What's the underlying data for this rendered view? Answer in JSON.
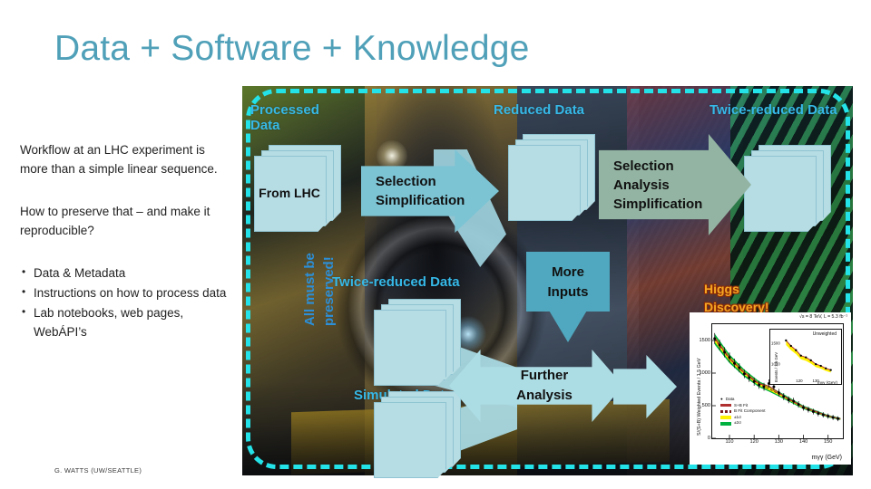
{
  "slide": {
    "title": "Data + Software + Knowledge",
    "title_color": "#4FA0B8",
    "footer_credit": "G. WATTS (UW/SEATTLE)"
  },
  "left_column": {
    "paragraph1": "Workflow at an LHC experiment is more than a simple linear sequence.",
    "paragraph2": "How to preserve that – and make it reproducible?",
    "bullets": [
      "Data & Metadata",
      "Instructions on how to process data",
      "Lab notebooks, web pages, WebÁPI’s"
    ]
  },
  "diagram": {
    "border_color": "#24E3E8",
    "label_color": "#36B9E8",
    "photo_labels": [
      "Processed Data",
      "Reduced Data",
      "Twice-reduced Data",
      "Twice-reduced Data",
      "Simulated Data"
    ],
    "processed_data_line1": "Processed",
    "processed_data_line2": "Data",
    "reduced_data": "Reduced Data",
    "twice_reduced_top": "Twice-reduced Data",
    "twice_reduced_mid": "Twice-reduced Data",
    "simulated_data": "Simulated Data",
    "preserved_line1": "All must be",
    "preserved_line2": "preserved!",
    "doc_from_lhc": "From LHC",
    "arrow_sel_simp_line1": "Selection",
    "arrow_sel_simp_line2": "Simplification",
    "arrow_sel_an_line1": "Selection",
    "arrow_sel_an_line2": "Analysis",
    "arrow_sel_an_line3": "Simplification",
    "more_inputs_line1": "More",
    "more_inputs_line2": "Inputs",
    "further_line1": "Further",
    "further_line2": "Analysis",
    "higgs_line1": "Higgs",
    "higgs_line2": "Discovery!",
    "higgs_color": "#F5A623"
  },
  "chart_data": {
    "type": "scatter",
    "title": "",
    "header_annotation": "√s = 8 TeV, L = 5.3 fb⁻¹",
    "xlabel": "mγγ (GeV)",
    "ylabel": "S/(S+B) Weighted Events / 1.5 GeV",
    "xlim": [
      103,
      156
    ],
    "ylim": [
      0,
      1750
    ],
    "xticks": [
      110,
      120,
      130,
      140,
      150
    ],
    "yticks": [
      0,
      500,
      1000,
      1500
    ],
    "grid": false,
    "legend_position": "lower-left",
    "legend": [
      "Data",
      "S+B Fit",
      "B Fit Component",
      "±1σ",
      "±2σ"
    ],
    "series": [
      {
        "name": "Data",
        "x": [
          104,
          106,
          108,
          110,
          112,
          114,
          116,
          118,
          120,
          122,
          124,
          126,
          128,
          130,
          132,
          134,
          136,
          138,
          140,
          142,
          144,
          146,
          148,
          150,
          152,
          154
        ],
        "values": [
          1530,
          1430,
          1320,
          1240,
          1150,
          1080,
          990,
          930,
          870,
          820,
          790,
          840,
          790,
          700,
          640,
          590,
          570,
          520,
          470,
          440,
          410,
          380,
          360,
          340,
          320,
          300
        ]
      },
      {
        "name": "S+B Fit",
        "x": [
          104,
          110,
          116,
          122,
          126,
          132,
          140,
          150,
          155
        ],
        "values": [
          1540,
          1230,
          1010,
          840,
          800,
          650,
          480,
          340,
          300
        ]
      },
      {
        "name": "B Fit Component",
        "x": [
          104,
          110,
          116,
          122,
          126,
          132,
          140,
          150,
          155
        ],
        "values": [
          1520,
          1220,
          1000,
          830,
          760,
          640,
          475,
          338,
          298
        ]
      }
    ],
    "inset": {
      "type": "scatter",
      "title": "Unweighted",
      "xlabel": "mγγ (GeV)",
      "ylabel": "Events / 1.5 GeV",
      "xticks": [
        120,
        130
      ],
      "yticks": [
        1000,
        1500
      ],
      "x": [
        112,
        115,
        118,
        121,
        124,
        127,
        130,
        133,
        136,
        139
      ],
      "values": [
        1560,
        1430,
        1330,
        1200,
        1160,
        1090,
        1000,
        960,
        900,
        860
      ]
    }
  }
}
